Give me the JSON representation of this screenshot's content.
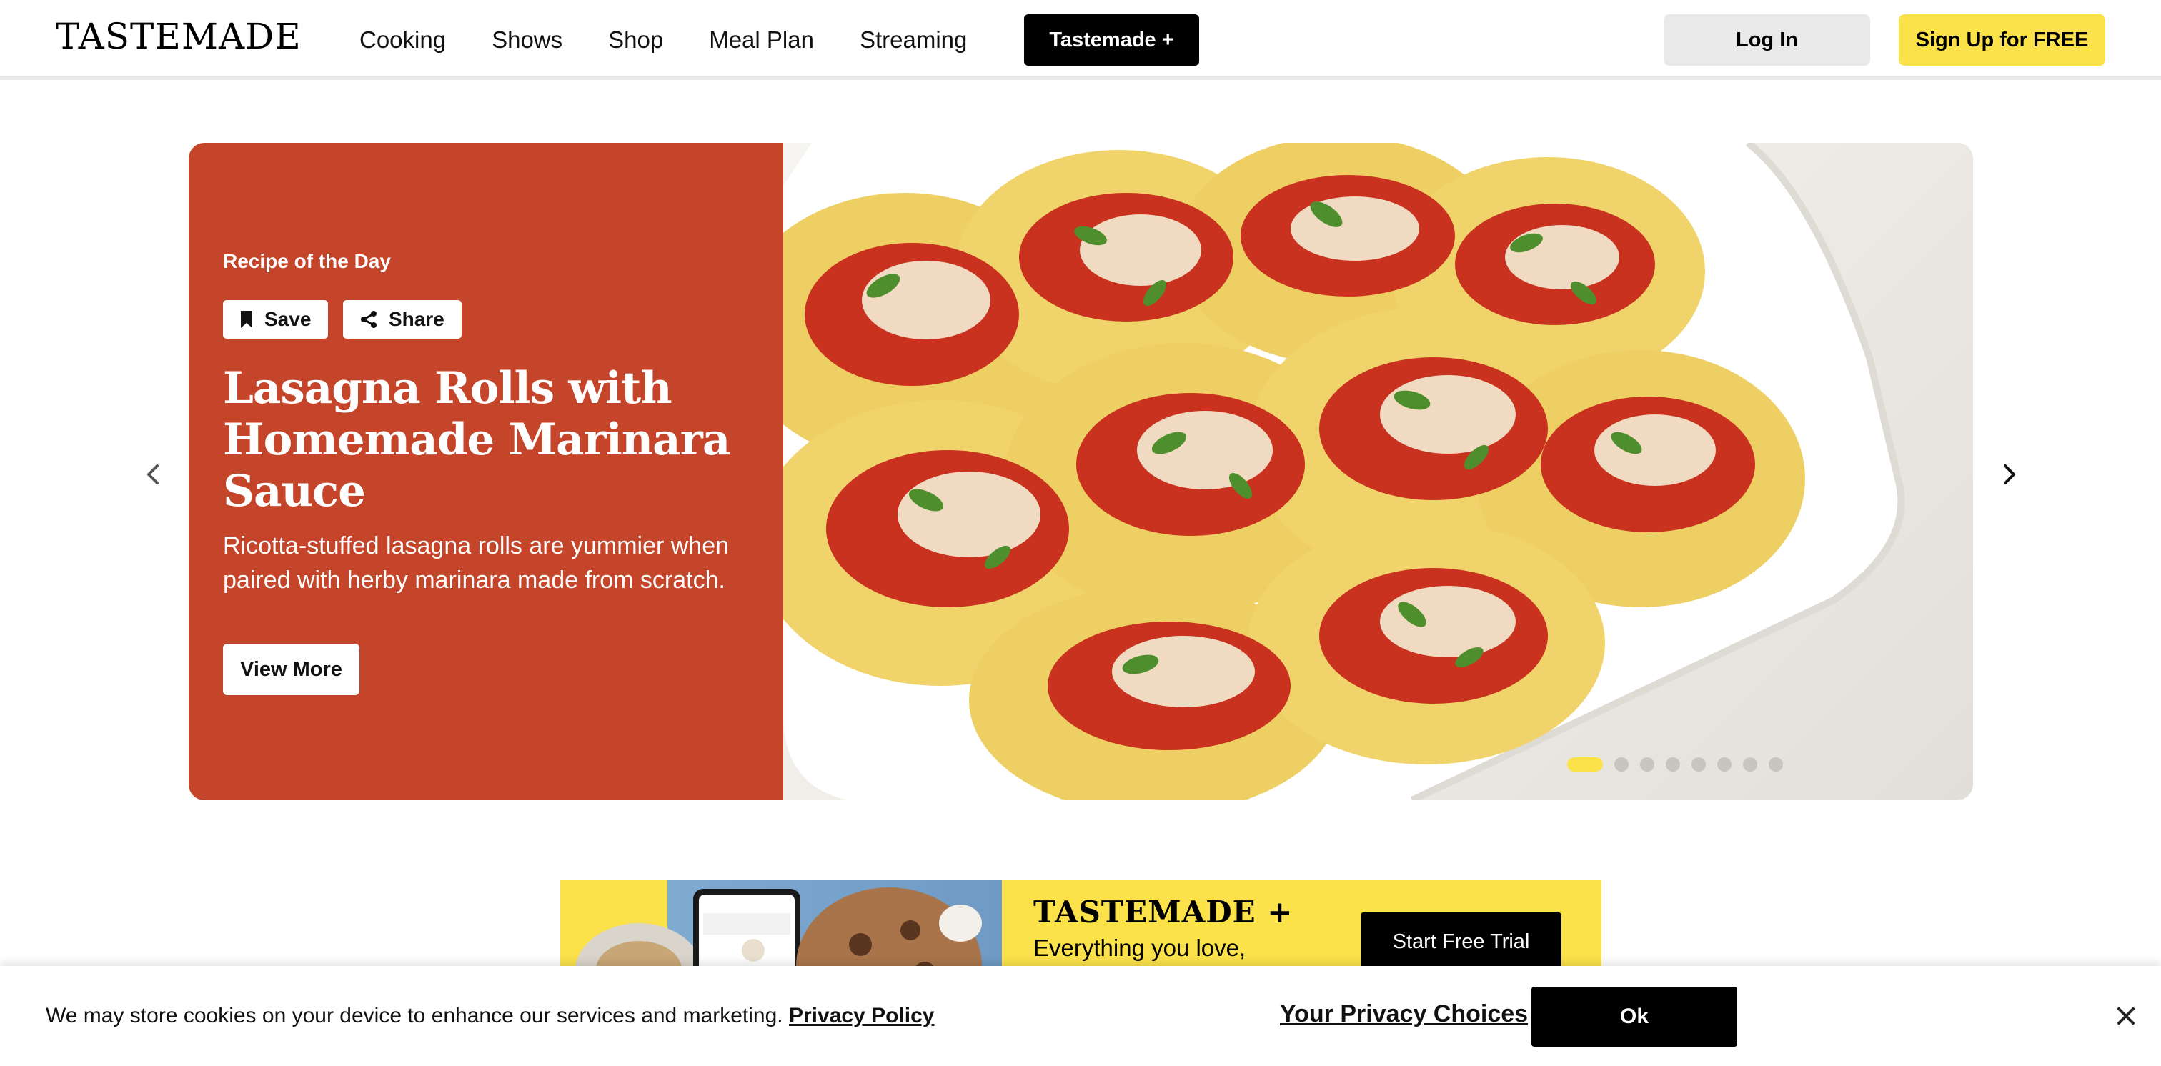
{
  "header": {
    "logo": "TASTEMADE",
    "nav": [
      "Cooking",
      "Shows",
      "Shop",
      "Meal Plan",
      "Streaming"
    ],
    "plus_label": "Tastemade +",
    "login_label": "Log In",
    "signup_label": "Sign Up for FREE"
  },
  "hero": {
    "eyebrow": "Recipe of the Day",
    "save_label": "Save",
    "share_label": "Share",
    "title": "Lasagna Rolls with Homemade Marinara Sauce",
    "description": "Ricotta-stuffed lasagna rolls are yummier when paired with herby marinara made from scratch.",
    "view_label": "View More",
    "slide_count": 8,
    "active_slide": 1
  },
  "promo": {
    "logo": "TASTEMADE +",
    "subtitle": "Everything you love,",
    "cta_label": "Start Free Trial"
  },
  "cookie": {
    "text": "We may store cookies on your device to enhance our services and marketing.",
    "policy_label": "Privacy Policy",
    "choices_label": "Your Privacy Choices",
    "ok_label": "Ok"
  },
  "colors": {
    "hero_panel": "#c5452a",
    "accent_yellow": "#fbe14a",
    "black": "#000000"
  },
  "icons": [
    "bookmark-icon",
    "share-icon",
    "chevron-left-icon",
    "chevron-right-icon",
    "close-icon"
  ]
}
